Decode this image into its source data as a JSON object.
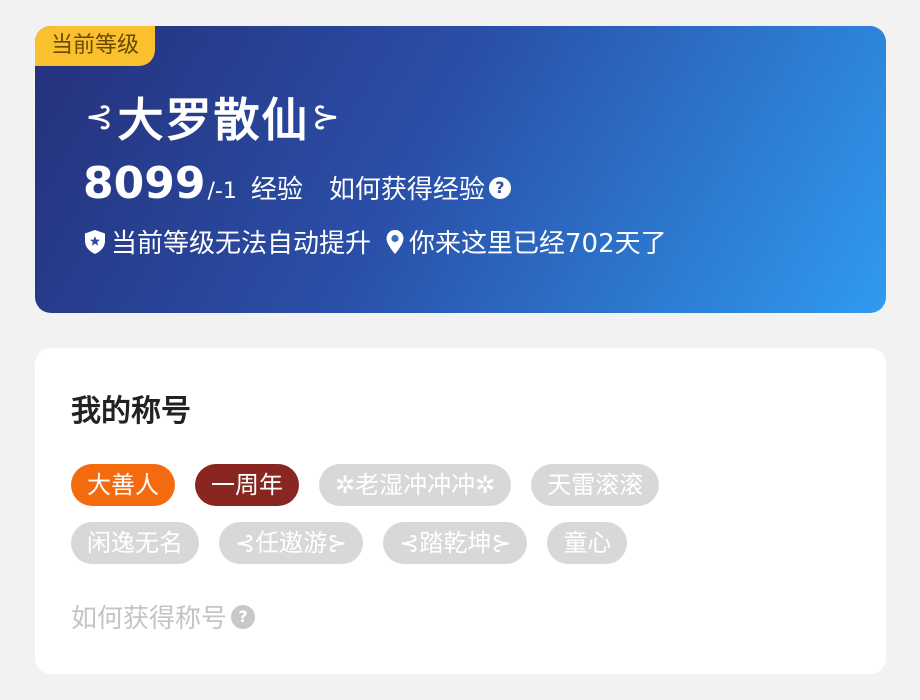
{
  "level_card": {
    "tag": "当前等级",
    "swirl_left": "⊰",
    "level_name": "大罗散仙",
    "swirl_right": "⊱",
    "exp_value": "8099",
    "exp_total": "/-1",
    "exp_unit": "经验",
    "how_to_gain_exp": "如何获得经验",
    "help_glyph": "?",
    "cannot_upgrade": "当前等级无法自动提升",
    "days_text": "你来这里已经702天了",
    "icons": [
      "shield-icon",
      "location-pin-icon",
      "question-icon"
    ]
  },
  "titles_card": {
    "heading": "我的称号",
    "tags_row1": [
      {
        "label": "大善人",
        "style": "orange"
      },
      {
        "label": "一周年",
        "style": "maroon"
      },
      {
        "label": "✲老湿冲冲冲✲",
        "style": "gray"
      },
      {
        "label": "天雷滚滚",
        "style": "gray"
      }
    ],
    "tags_row2": [
      {
        "label": "闲逸无名",
        "style": "gray"
      },
      {
        "label": "⊰任遨游⊱",
        "style": "gray"
      },
      {
        "label": "⊰踏乾坤⊱",
        "style": "gray"
      },
      {
        "label": "童心",
        "style": "gray"
      }
    ],
    "how_to_gain_title": "如何获得称号",
    "help_glyph": "?"
  },
  "colors": {
    "gradient_start": "#25307a",
    "gradient_end": "#2f9bf0",
    "level_tag_bg": "#fbc02d",
    "tag_orange": "#f46b0f",
    "tag_maroon": "#8a2621",
    "tag_gray": "#d8d8d8"
  }
}
